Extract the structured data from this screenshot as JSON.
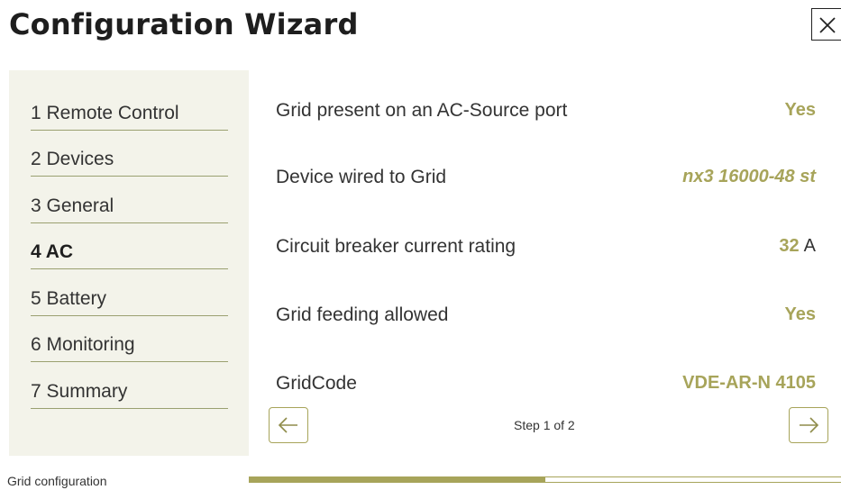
{
  "header": {
    "title": "Configuration Wizard",
    "close_icon": "close-icon"
  },
  "sidebar": {
    "items": [
      {
        "label": "1 Remote Control",
        "active": false
      },
      {
        "label": "2 Devices",
        "active": false
      },
      {
        "label": "3 General",
        "active": false
      },
      {
        "label": "4 AC",
        "active": true
      },
      {
        "label": "5 Battery",
        "active": false
      },
      {
        "label": "6 Monitoring",
        "active": false
      },
      {
        "label": "7 Summary",
        "active": false
      }
    ]
  },
  "main": {
    "rows": [
      {
        "label": "Grid present on an AC-Source port",
        "value": "Yes"
      },
      {
        "label": "Device wired to Grid",
        "value": "nx3 16000-48 st"
      },
      {
        "label": "Circuit breaker current rating",
        "value": "32",
        "unit": "A"
      },
      {
        "label": "Grid feeding allowed",
        "value": "Yes"
      },
      {
        "label": "GridCode",
        "value": "VDE-AR-N 4105"
      }
    ],
    "step_counter": "Step 1 of 2",
    "prev_icon": "arrow-left-icon",
    "next_icon": "arrow-right-icon"
  },
  "footer": {
    "label": "Grid configuration",
    "progress": 0.5
  },
  "colors": {
    "accent": "#a7a45a",
    "sidebar_bg": "#f3f3ea",
    "text": "#333333"
  }
}
